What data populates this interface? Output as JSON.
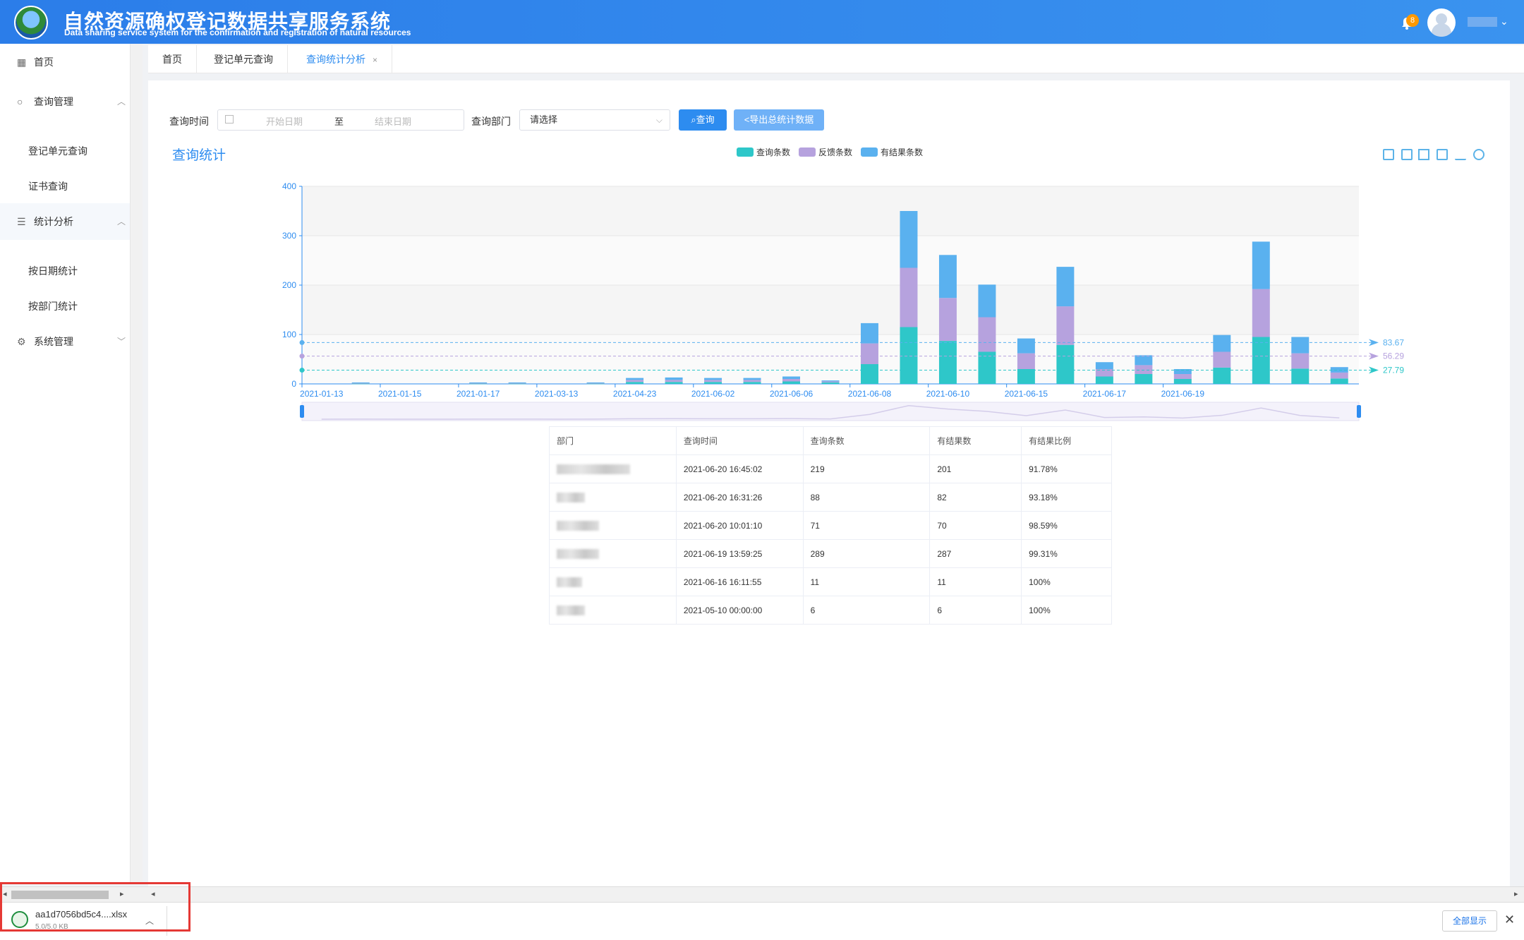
{
  "header": {
    "title_cn": "自然资源确权登记数据共享服务系统",
    "title_en": "Data sharing service system for the confirmation and registration of natural resources",
    "notification_count": "8"
  },
  "sidebar": {
    "home": "首页",
    "query_mgmt": "查询管理",
    "reg_unit_query": "登记单元查询",
    "cert_query": "证书查询",
    "stats": "统计分析",
    "by_date": "按日期统计",
    "by_dept": "按部门统计",
    "sys_mgmt": "系统管理"
  },
  "tabs": {
    "home": "首页",
    "reg_unit": "登记单元查询",
    "stats_analysis": "查询统计分析",
    "close": "×"
  },
  "filter": {
    "time_label": "查询时间",
    "start_placeholder": "开始日期",
    "to": "至",
    "end_placeholder": "结束日期",
    "dept_label": "查询部门",
    "dept_value": "请选择",
    "query_btn": "查询",
    "export_btn": "导出总统计数据"
  },
  "chart_title": "查询统计",
  "colors": {
    "query": "#2ec7c9",
    "feedback": "#b6a2de",
    "result": "#5ab1ef",
    "accent": "#2d8cf0"
  },
  "chart_data": {
    "type": "bar",
    "stacked": true,
    "ylim": [
      0,
      400
    ],
    "yticks": [
      0,
      100,
      200,
      300,
      400
    ],
    "x_tick_labels": [
      "2021-01-13",
      "2021-01-15",
      "2021-01-17",
      "2021-03-13",
      "2021-04-23",
      "2021-06-02",
      "2021-06-06",
      "2021-06-08",
      "2021-06-10",
      "2021-06-15",
      "2021-06-17",
      "2021-06-19"
    ],
    "series": [
      {
        "name": "查询条数",
        "values": [
          0,
          1,
          0,
          0,
          1,
          1,
          0,
          1,
          4,
          4,
          4,
          4,
          5,
          3,
          40,
          115,
          87,
          65,
          30,
          79,
          15,
          20,
          10,
          33,
          95,
          31,
          11
        ]
      },
      {
        "name": "反馈条数",
        "values": [
          0,
          1,
          0,
          0,
          1,
          1,
          0,
          1,
          4,
          4,
          4,
          4,
          5,
          2,
          42,
          120,
          87,
          70,
          32,
          78,
          15,
          18,
          10,
          32,
          97,
          31,
          12
        ]
      },
      {
        "name": "有结果条数",
        "values": [
          0,
          1,
          0,
          0,
          1,
          1,
          0,
          1,
          4,
          5,
          4,
          4,
          5,
          2,
          41,
          115,
          87,
          66,
          30,
          80,
          14,
          20,
          10,
          34,
          96,
          33,
          11
        ]
      }
    ],
    "mark_lines": [
      {
        "series": "有结果条数",
        "value": 83.67,
        "label": "83.67"
      },
      {
        "series": "反馈条数",
        "value": 56.29,
        "label": "56.29"
      },
      {
        "series": "查询条数",
        "value": 27.79,
        "label": "27.79"
      }
    ],
    "legend": [
      "查询条数",
      "反馈条数",
      "有结果条数"
    ],
    "legend_position": "top-center"
  },
  "table": {
    "headers": [
      "部门",
      "查询时间",
      "查询条数",
      "有结果数",
      "有结果比例"
    ],
    "rows": [
      {
        "time": "2021-06-20 16:45:02",
        "count": "219",
        "results": "201",
        "ratio": "91.78%"
      },
      {
        "time": "2021-06-20 16:31:26",
        "count": "88",
        "results": "82",
        "ratio": "93.18%"
      },
      {
        "time": "2021-06-20 10:01:10",
        "count": "71",
        "results": "70",
        "ratio": "98.59%"
      },
      {
        "time": "2021-06-19 13:59:25",
        "count": "289",
        "results": "287",
        "ratio": "99.31%"
      },
      {
        "time": "2021-06-16 16:11:55",
        "count": "11",
        "results": "11",
        "ratio": "100%"
      },
      {
        "time": "2021-05-10 00:00:00",
        "count": "6",
        "results": "6",
        "ratio": "100%"
      }
    ]
  },
  "download": {
    "file_name": "aa1d7056bd5c4....xlsx",
    "file_size": "5.0/5.0 KB",
    "show_all": "全部显示",
    "close": "✕"
  }
}
